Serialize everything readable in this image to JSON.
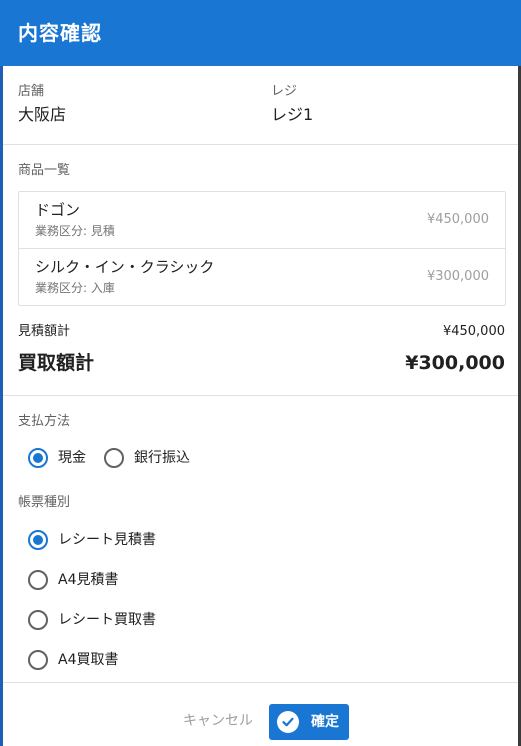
{
  "dialog": {
    "title": "内容確認"
  },
  "info": {
    "store_label": "店舗",
    "store_value": "大阪店",
    "register_label": "レジ",
    "register_value": "レジ1"
  },
  "items": {
    "heading": "商品一覧",
    "rows": [
      {
        "name": "ドゴン",
        "category": "業務区分: 見積",
        "price": "¥450,000"
      },
      {
        "name": "シルク・イン・クラシック",
        "category": "業務区分: 入庫",
        "price": "¥300,000"
      }
    ]
  },
  "totals": {
    "estimate_label": "見積額計",
    "estimate_value": "¥450,000",
    "purchase_label": "買取額計",
    "purchase_value": "¥300,000"
  },
  "payment": {
    "heading": "支払方法",
    "options": [
      {
        "label": "現金",
        "checked": true
      },
      {
        "label": "銀行振込",
        "checked": false
      }
    ]
  },
  "document": {
    "heading": "帳票種別",
    "options": [
      {
        "label": "レシート見積書",
        "checked": true
      },
      {
        "label": "A4見積書",
        "checked": false
      },
      {
        "label": "レシート買取書",
        "checked": false
      },
      {
        "label": "A4買取書",
        "checked": false
      }
    ]
  },
  "actions": {
    "cancel_label": "キャンセル",
    "confirm_label": "確定",
    "confirm_icon": "check-circle-icon"
  },
  "colors": {
    "primary": "#1976d2",
    "text": "#212121",
    "muted": "#9e9e9e"
  }
}
